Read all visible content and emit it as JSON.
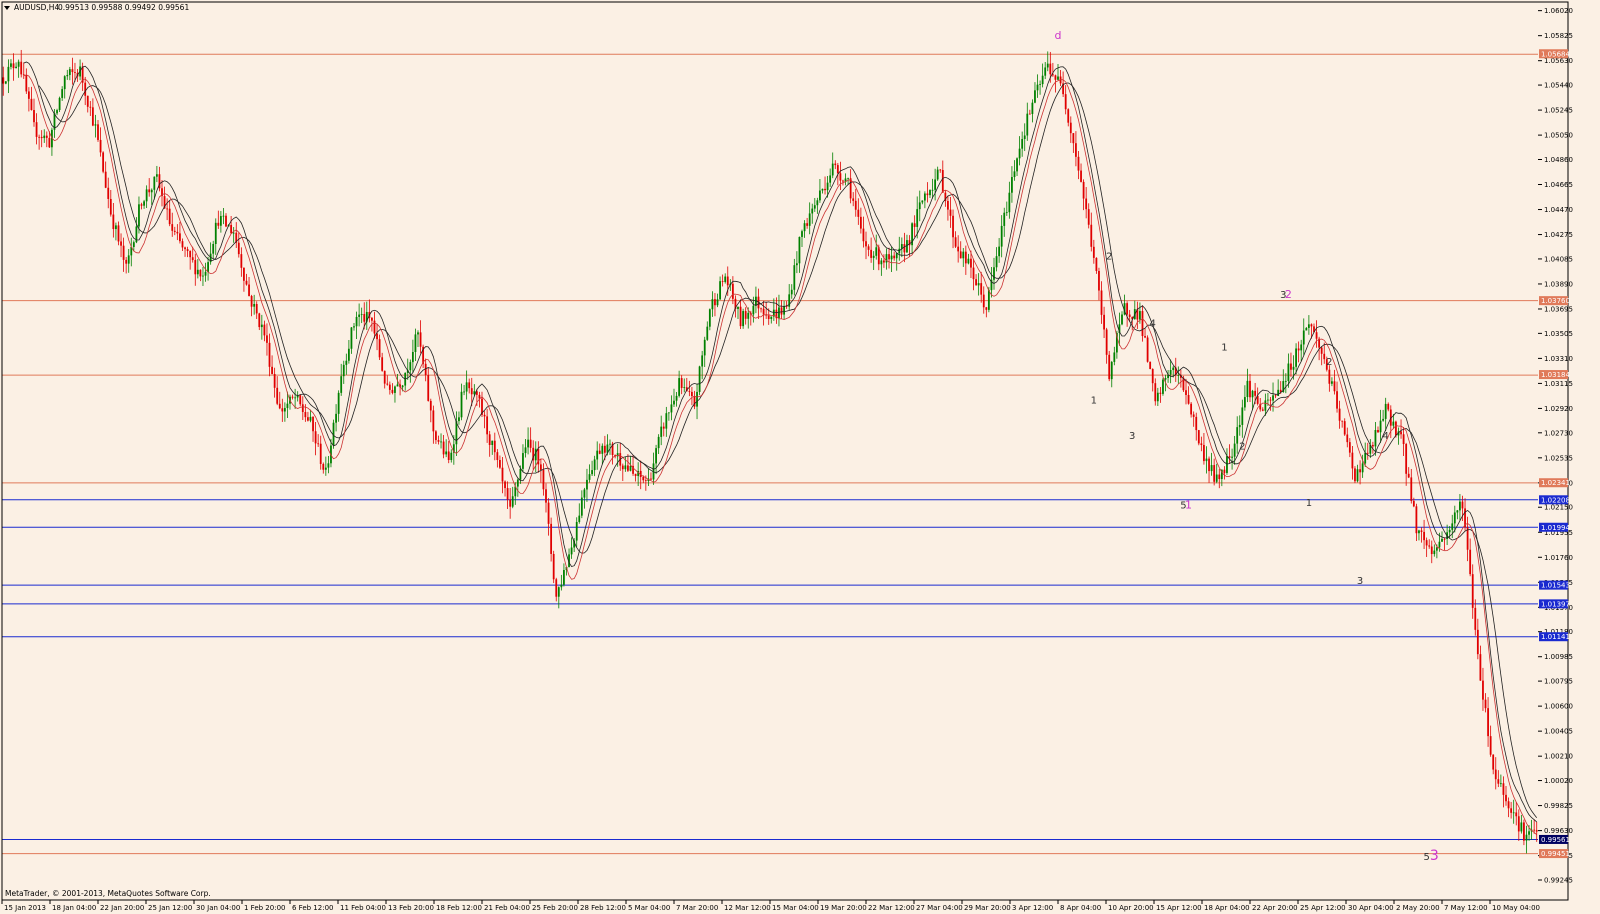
{
  "header": {
    "symbol": "AUDUSD,H4",
    "ohlc": "0.99513 0.99588 0.99492 0.99561"
  },
  "footer": {
    "copyright": "MetaTrader, © 2001-2013, MetaQuotes Software Corp."
  },
  "colors": {
    "background": "#fbf0e4",
    "bull": "#008000",
    "bear": "#e00000",
    "ma": "#222222",
    "ma_red": "#cc3333",
    "hline_orange": "#e07a5a",
    "hline_blue": "#1a2ad0",
    "axis": "#000000",
    "wave_magenta": "#cc33cc"
  },
  "chart_data": {
    "type": "candlestick",
    "ylim": [
      0.99245,
      1.06025
    ],
    "y_ticks": [
      "1.06020",
      "1.05825",
      "1.05630",
      "1.05440",
      "1.05245",
      "1.05050",
      "1.04860",
      "1.04665",
      "1.04470",
      "1.04275",
      "1.04085",
      "1.03890",
      "1.03695",
      "1.03505",
      "1.03310",
      "1.03115",
      "1.02920",
      "1.02730",
      "1.02535",
      "1.02340",
      "1.02150",
      "1.01955",
      "1.01760",
      "1.01565",
      "1.01370",
      "1.01180",
      "1.00985",
      "1.00795",
      "1.00600",
      "1.00405",
      "1.00210",
      "1.00020",
      "0.99825",
      "0.99630",
      "0.99435",
      "0.99245"
    ],
    "x_ticks": [
      "15 Jan 2013",
      "18 Jan 04:00",
      "22 Jan 20:00",
      "25 Jan 12:00",
      "30 Jan 04:00",
      "1 Feb 20:00",
      "6 Feb 12:00",
      "11 Feb 04:00",
      "13 Feb 20:00",
      "18 Feb 12:00",
      "21 Feb 04:00",
      "25 Feb 20:00",
      "28 Feb 12:00",
      "5 Mar 04:00",
      "7 Mar 20:00",
      "12 Mar 12:00",
      "15 Mar 04:00",
      "19 Mar 20:00",
      "22 Mar 12:00",
      "27 Mar 04:00",
      "29 Mar 20:00",
      "3 Apr 12:00",
      "8 Apr 04:00",
      "10 Apr 20:00",
      "15 Apr 12:00",
      "18 Apr 04:00",
      "22 Apr 20:00",
      "25 Apr 12:00",
      "30 Apr 04:00",
      "2 May 20:00",
      "7 May 12:00",
      "10 May 04:00"
    ],
    "price_path": [
      [
        0,
        1.055
      ],
      [
        6,
        1.0565
      ],
      [
        12,
        1.051
      ],
      [
        18,
        1.05
      ],
      [
        24,
        1.055
      ],
      [
        30,
        1.0555
      ],
      [
        36,
        1.051
      ],
      [
        42,
        1.0445
      ],
      [
        48,
        1.04
      ],
      [
        54,
        1.0455
      ],
      [
        60,
        1.047
      ],
      [
        66,
        1.043
      ],
      [
        72,
        1.041
      ],
      [
        78,
        1.0395
      ],
      [
        84,
        1.044
      ],
      [
        90,
        1.043
      ],
      [
        96,
        1.038
      ],
      [
        102,
        1.035
      ],
      [
        108,
        1.029
      ],
      [
        114,
        1.03
      ],
      [
        120,
        1.028
      ],
      [
        126,
        1.024
      ],
      [
        132,
        1.032
      ],
      [
        138,
        1.0365
      ],
      [
        144,
        1.036
      ],
      [
        150,
        1.0305
      ],
      [
        156,
        1.0315
      ],
      [
        162,
        1.035
      ],
      [
        168,
        1.0275
      ],
      [
        174,
        1.025
      ],
      [
        180,
        1.031
      ],
      [
        186,
        1.0295
      ],
      [
        192,
        1.0255
      ],
      [
        198,
        1.021
      ],
      [
        204,
        1.0265
      ],
      [
        210,
        1.025
      ],
      [
        216,
        1.0145
      ],
      [
        222,
        1.0185
      ],
      [
        228,
        1.024
      ],
      [
        234,
        1.0265
      ],
      [
        240,
        1.0255
      ],
      [
        246,
        1.024
      ],
      [
        252,
        1.0235
      ],
      [
        258,
        1.028
      ],
      [
        264,
        1.031
      ],
      [
        270,
        1.0295
      ],
      [
        276,
        1.037
      ],
      [
        282,
        1.0395
      ],
      [
        288,
        1.036
      ],
      [
        294,
        1.0375
      ],
      [
        300,
        1.0365
      ],
      [
        306,
        1.037
      ],
      [
        312,
        1.043
      ],
      [
        318,
        1.0455
      ],
      [
        324,
        1.048
      ],
      [
        330,
        1.047
      ],
      [
        336,
        1.042
      ],
      [
        342,
        1.041
      ],
      [
        348,
        1.0405
      ],
      [
        354,
        1.0425
      ],
      [
        360,
        1.046
      ],
      [
        366,
        1.0475
      ],
      [
        372,
        1.042
      ],
      [
        378,
        1.04
      ],
      [
        384,
        1.037
      ],
      [
        390,
        1.043
      ],
      [
        396,
        1.049
      ],
      [
        402,
        1.053
      ],
      [
        408,
        1.056
      ],
      [
        414,
        1.054
      ],
      [
        420,
        1.048
      ],
      [
        426,
        1.041
      ],
      [
        432,
        1.032
      ],
      [
        438,
        1.037
      ],
      [
        444,
        1.0365
      ],
      [
        450,
        1.0295
      ],
      [
        456,
        1.0325
      ],
      [
        462,
        1.0305
      ],
      [
        468,
        1.026
      ],
      [
        474,
        1.0235
      ],
      [
        480,
        1.026
      ],
      [
        486,
        1.031
      ],
      [
        492,
        1.029
      ],
      [
        498,
        1.0305
      ],
      [
        504,
        1.033
      ],
      [
        510,
        1.036
      ],
      [
        516,
        1.033
      ],
      [
        522,
        1.0285
      ],
      [
        528,
        1.024
      ],
      [
        534,
        1.026
      ],
      [
        540,
        1.029
      ],
      [
        546,
        1.027
      ],
      [
        552,
        1.02
      ],
      [
        558,
        1.018
      ],
      [
        564,
        1.0195
      ],
      [
        570,
        1.022
      ],
      [
        576,
        1.01
      ],
      [
        582,
        1.001
      ],
      [
        588,
        0.9985
      ],
      [
        594,
        0.996
      ]
    ],
    "levels_orange": [
      1.0568,
      1.0376,
      1.0318,
      1.0234,
      0.99451
    ],
    "levels_blue": [
      1.02208,
      1.01994,
      1.01543,
      1.01397,
      1.01141,
      0.99561
    ],
    "tag_values": [
      "1.05684",
      "1.03760",
      "1.03184",
      "1.02341",
      "1.02208",
      "1.01994",
      "1.01543",
      "1.01397",
      "1.01141",
      "0.99561",
      "0.99451"
    ],
    "wave_labels": [
      {
        "t": "d",
        "x": 412,
        "y": 1.058,
        "style": "mag"
      },
      {
        "t": "1",
        "x": 426,
        "y": 1.0296,
        "style": "num"
      },
      {
        "t": "2",
        "x": 432,
        "y": 1.0408,
        "style": "num"
      },
      {
        "t": "3",
        "x": 441,
        "y": 1.0268,
        "style": "num"
      },
      {
        "t": "4",
        "x": 449,
        "y": 1.0356,
        "style": "num"
      },
      {
        "t": "5",
        "x": 461,
        "y": 1.0214,
        "style": "num"
      },
      {
        "t": "1",
        "x": 463,
        "y": 1.0214,
        "style": "mag"
      },
      {
        "t": "1",
        "x": 477,
        "y": 1.0337,
        "style": "num"
      },
      {
        "t": "2",
        "x": 484,
        "y": 1.026,
        "style": "num"
      },
      {
        "t": "3",
        "x": 500,
        "y": 1.0378,
        "style": "num"
      },
      {
        "t": "2",
        "x": 502,
        "y": 1.0378,
        "style": "mag"
      },
      {
        "t": "2",
        "x": 518,
        "y": 1.0326,
        "style": "num"
      },
      {
        "t": "1",
        "x": 510,
        "y": 1.0216,
        "style": "num"
      },
      {
        "t": "4",
        "x": 540,
        "y": 1.0268,
        "style": "num"
      },
      {
        "t": "3",
        "x": 530,
        "y": 1.0155,
        "style": "num"
      },
      {
        "t": "5",
        "x": 556,
        "y": 0.994,
        "style": "num"
      },
      {
        "t": "3",
        "x": 559,
        "y": 0.994,
        "style": "big"
      }
    ]
  }
}
